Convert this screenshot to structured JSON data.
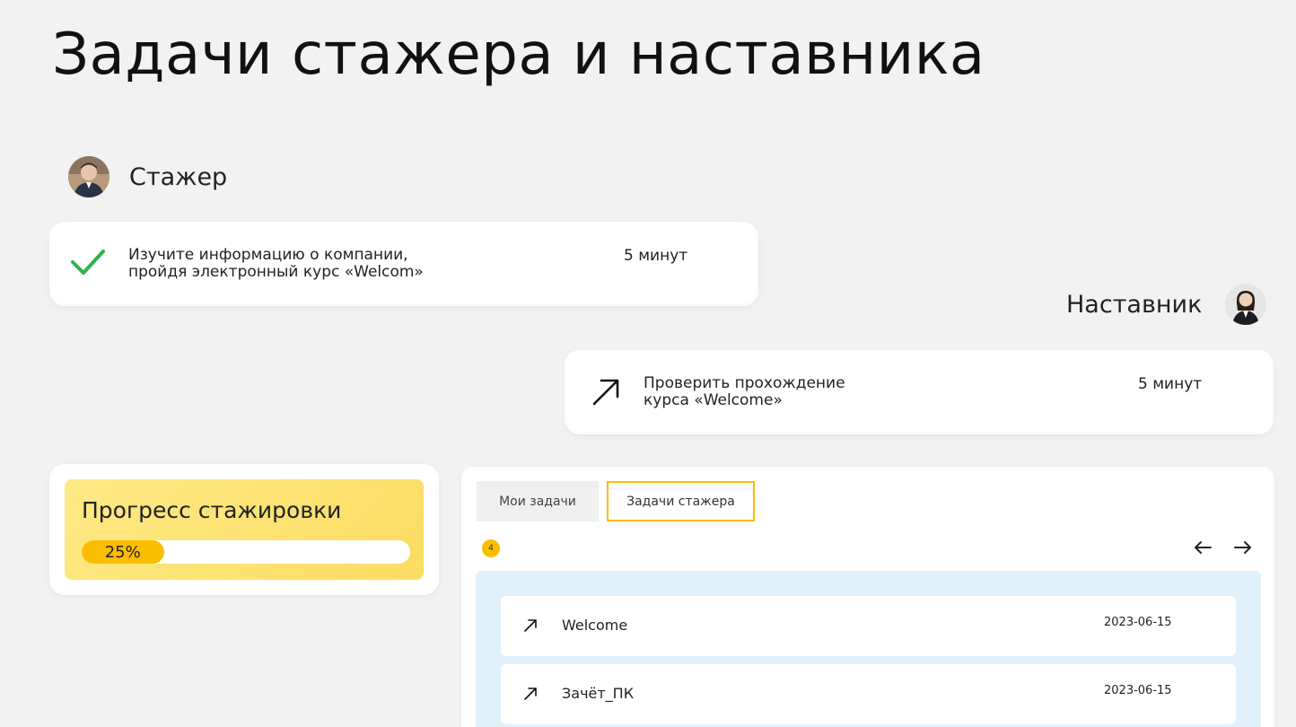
{
  "page": {
    "title": "Задачи стажера и наставника"
  },
  "intern": {
    "role_label": "Стажер",
    "avatar_icon": "intern-avatar",
    "task": {
      "status_icon": "check-icon",
      "text": "Изучите информацию о компании,\nпройдя электронный курс «Welcom»",
      "duration": "5 минут"
    }
  },
  "mentor": {
    "role_label": "Наставник",
    "avatar_icon": "mentor-avatar",
    "task": {
      "status_icon": "arrow-up-right-icon",
      "text": "Проверить прохождение\nкурса «Welcome»",
      "duration": "5 минут"
    }
  },
  "progress": {
    "title": "Прогресс стажировки",
    "percent_label": "25%",
    "value": 0.25
  },
  "tasks_panel": {
    "tabs": [
      {
        "label": "Мои задачи",
        "active": false
      },
      {
        "label": "Задачи стажера",
        "active": true
      }
    ],
    "count": "4",
    "nav_prev_icon": "arrow-left-icon",
    "nav_next_icon": "arrow-right-icon",
    "rows": [
      {
        "icon": "arrow-up-right-icon",
        "title": "Welcome",
        "date": "2023-06-15"
      },
      {
        "icon": "arrow-up-right-icon",
        "title": "Зачёт_ПК",
        "date": "2023-06-15"
      }
    ]
  },
  "colors": {
    "accent": "#fbbd00",
    "check": "#2fb24a",
    "list_bg": "#e1f1fc",
    "page_bg": "#f2f2f2"
  }
}
